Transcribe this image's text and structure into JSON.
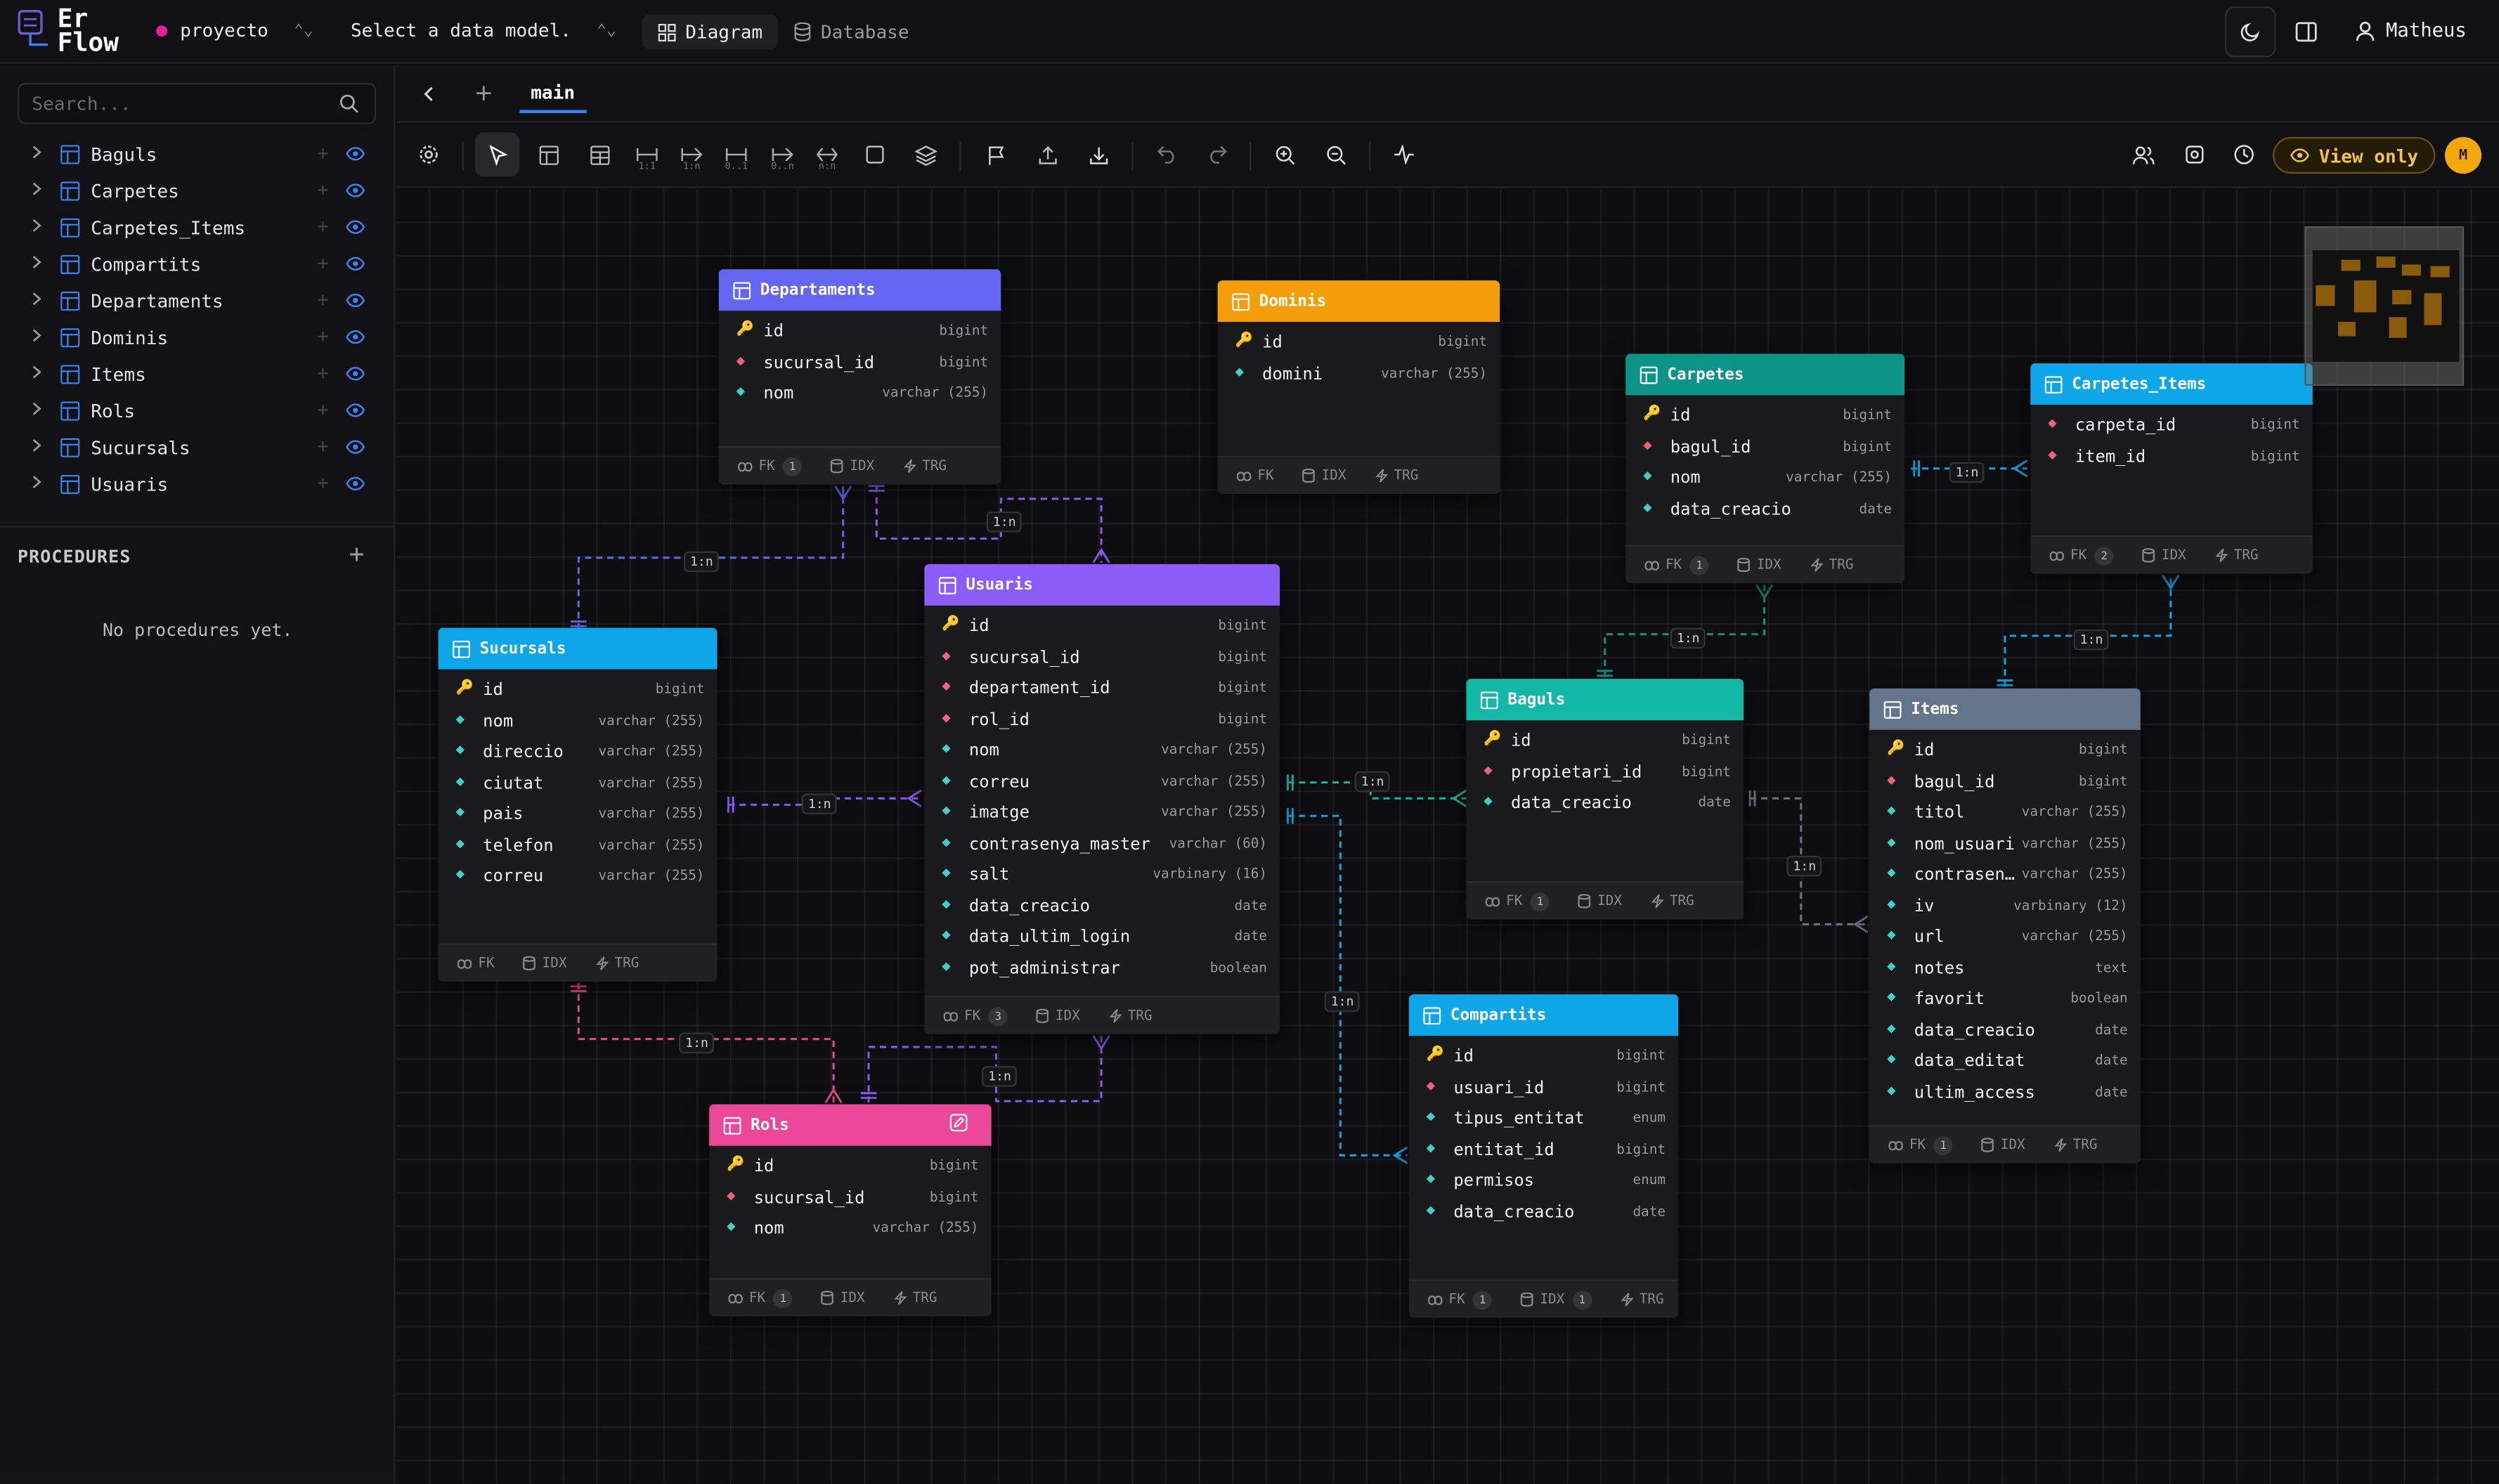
{
  "header": {
    "logo_line1": "Er",
    "logo_line2": "Flow",
    "project": "proyecto",
    "model": "Select a data model.",
    "tab_diagram": "Diagram",
    "tab_database": "Database",
    "user": "Matheus"
  },
  "sidebar": {
    "search_placeholder": "Search...",
    "tables": [
      "Baguls",
      "Carpetes",
      "Carpetes_Items",
      "Compartits",
      "Departaments",
      "Dominis",
      "Items",
      "Rols",
      "Sucursals",
      "Usuaris"
    ],
    "procedures_title": "PROCEDURES",
    "procedures_empty": "No procedures yet."
  },
  "canvas": {
    "branch_tab": "main",
    "view_only": "View only",
    "avatar": "M",
    "toolbar_labels": {
      "one_one": "1:1",
      "one_n": "1:n",
      "zero_one": "0..1",
      "zero_n": "0..n",
      "n_n": "n:n"
    }
  },
  "colors": {
    "Departaments": "#6366f1",
    "Dominis": "#f59e0b",
    "Carpetes": "#0d9488",
    "Carpetes_Items": "#0ea5e9",
    "Usuaris": "#8b5cf6",
    "Sucursals": "#0ea5e9",
    "Baguls": "#14b8a6",
    "Items": "#64748b",
    "Rols": "#ec4899",
    "Compartits": "#0ea5e9"
  },
  "footer_labels": {
    "fk": "FK",
    "idx": "IDX",
    "trg": "TRG"
  },
  "tables": {
    "Departaments": {
      "title": "Departaments",
      "fk": "1",
      "columns": [
        {
          "n": "id",
          "t": "bigint",
          "k": "pk"
        },
        {
          "n": "sucursal_id",
          "t": "bigint",
          "k": "fk"
        },
        {
          "n": "nom",
          "t": "varchar (255)",
          "k": "cl"
        }
      ]
    },
    "Dominis": {
      "title": "Dominis",
      "columns": [
        {
          "n": "id",
          "t": "bigint",
          "k": "pk"
        },
        {
          "n": "domini",
          "t": "varchar (255)",
          "k": "cl"
        }
      ]
    },
    "Carpetes": {
      "title": "Carpetes",
      "fk": "1",
      "columns": [
        {
          "n": "id",
          "t": "bigint",
          "k": "pk"
        },
        {
          "n": "bagul_id",
          "t": "bigint",
          "k": "fk"
        },
        {
          "n": "nom",
          "t": "varchar (255)",
          "k": "cl"
        },
        {
          "n": "data_creacio",
          "t": "date",
          "k": "cl"
        }
      ]
    },
    "Carpetes_Items": {
      "title": "Carpetes_Items",
      "fk": "2",
      "columns": [
        {
          "n": "carpeta_id",
          "t": "bigint",
          "k": "fk"
        },
        {
          "n": "item_id",
          "t": "bigint",
          "k": "fk"
        }
      ]
    },
    "Usuaris": {
      "title": "Usuaris",
      "fk": "3",
      "columns": [
        {
          "n": "id",
          "t": "bigint",
          "k": "pk"
        },
        {
          "n": "sucursal_id",
          "t": "bigint",
          "k": "fk"
        },
        {
          "n": "departament_id",
          "t": "bigint",
          "k": "fk"
        },
        {
          "n": "rol_id",
          "t": "bigint",
          "k": "fk"
        },
        {
          "n": "nom",
          "t": "varchar (255)",
          "k": "cl"
        },
        {
          "n": "correu",
          "t": "varchar (255)",
          "k": "cl"
        },
        {
          "n": "imatge",
          "t": "varchar (255)",
          "k": "cl"
        },
        {
          "n": "contrasenya_master",
          "t": "varchar (60)",
          "k": "cl"
        },
        {
          "n": "salt",
          "t": "varbinary (16)",
          "k": "cl"
        },
        {
          "n": "data_creacio",
          "t": "date",
          "k": "cl"
        },
        {
          "n": "data_ultim_login",
          "t": "date",
          "k": "cl"
        },
        {
          "n": "pot_administrar",
          "t": "boolean",
          "k": "cl"
        }
      ]
    },
    "Sucursals": {
      "title": "Sucursals",
      "columns": [
        {
          "n": "id",
          "t": "bigint",
          "k": "pk"
        },
        {
          "n": "nom",
          "t": "varchar (255)",
          "k": "cl"
        },
        {
          "n": "direccio",
          "t": "varchar (255)",
          "k": "cl"
        },
        {
          "n": "ciutat",
          "t": "varchar (255)",
          "k": "cl"
        },
        {
          "n": "pais",
          "t": "varchar (255)",
          "k": "cl"
        },
        {
          "n": "telefon",
          "t": "varchar (255)",
          "k": "cl"
        },
        {
          "n": "correu",
          "t": "varchar (255)",
          "k": "cl"
        }
      ]
    },
    "Baguls": {
      "title": "Baguls",
      "fk": "1",
      "columns": [
        {
          "n": "id",
          "t": "bigint",
          "k": "pk"
        },
        {
          "n": "propietari_id",
          "t": "bigint",
          "k": "fk"
        },
        {
          "n": "data_creacio",
          "t": "date",
          "k": "cl"
        }
      ]
    },
    "Items": {
      "title": "Items",
      "fk": "1",
      "columns": [
        {
          "n": "id",
          "t": "bigint",
          "k": "pk"
        },
        {
          "n": "bagul_id",
          "t": "bigint",
          "k": "fk"
        },
        {
          "n": "titol",
          "t": "varchar (255)",
          "k": "cl"
        },
        {
          "n": "nom_usuari",
          "t": "varchar (255)",
          "k": "cl"
        },
        {
          "n": "contrasen…",
          "t": "varchar (255)",
          "k": "cl"
        },
        {
          "n": "iv",
          "t": "varbinary (12)",
          "k": "cl"
        },
        {
          "n": "url",
          "t": "varchar (255)",
          "k": "cl"
        },
        {
          "n": "notes",
          "t": "text",
          "k": "cl"
        },
        {
          "n": "favorit",
          "t": "boolean",
          "k": "cl"
        },
        {
          "n": "data_creacio",
          "t": "date",
          "k": "cl"
        },
        {
          "n": "data_editat",
          "t": "date",
          "k": "cl"
        },
        {
          "n": "ultim_access",
          "t": "date",
          "k": "cl"
        }
      ]
    },
    "Rols": {
      "title": "Rols",
      "fk": "1",
      "columns": [
        {
          "n": "id",
          "t": "bigint",
          "k": "pk"
        },
        {
          "n": "sucursal_id",
          "t": "bigint",
          "k": "fk"
        },
        {
          "n": "nom",
          "t": "varchar (255)",
          "k": "cl"
        }
      ]
    },
    "Compartits": {
      "title": "Compartits",
      "fk": "1",
      "idx": "1",
      "columns": [
        {
          "n": "id",
          "t": "bigint",
          "k": "pk"
        },
        {
          "n": "usuari_id",
          "t": "bigint",
          "k": "fk"
        },
        {
          "n": "tipus_entitat",
          "t": "enum",
          "k": "cl"
        },
        {
          "n": "entitat_id",
          "t": "bigint",
          "k": "cl"
        },
        {
          "n": "permisos",
          "t": "enum",
          "k": "cl"
        },
        {
          "n": "data_creacio",
          "t": "date",
          "k": "cl"
        }
      ]
    }
  },
  "relationship_label": "1:n"
}
